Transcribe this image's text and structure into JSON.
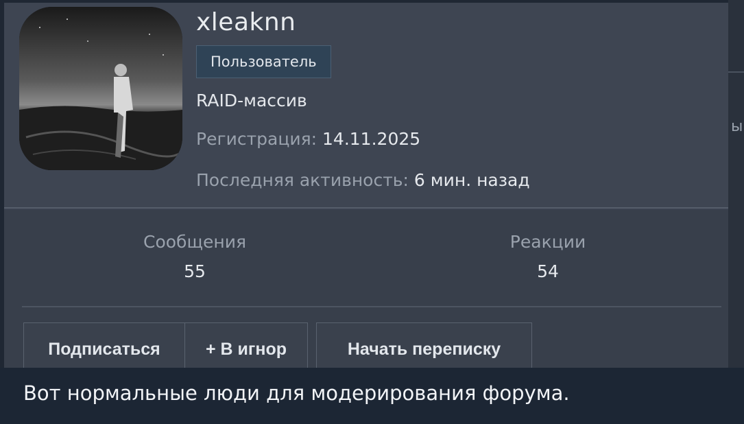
{
  "profile": {
    "username": "xleaknn",
    "role_badge": "Пользователь",
    "user_title": "RAID-массив",
    "registration_label": "Регистрация:",
    "registration_value": "14.11.2025",
    "activity_label": "Последняя активность:",
    "activity_value": "6 мин. назад"
  },
  "stats": {
    "messages_label": "Сообщения",
    "messages_value": "55",
    "reactions_label": "Реакции",
    "reactions_value": "54"
  },
  "actions": {
    "follow": "Подписаться",
    "ignore": "+ В игнор",
    "start_conversation": "Начать переписку"
  },
  "caption": {
    "text": "Вот нормальные люди для модерирования форума."
  },
  "edge": {
    "glyph": "ы"
  },
  "colors": {
    "card_bg": "#3e4552",
    "badge_bg": "#2f4356",
    "caption_bg": "#1c2634"
  }
}
